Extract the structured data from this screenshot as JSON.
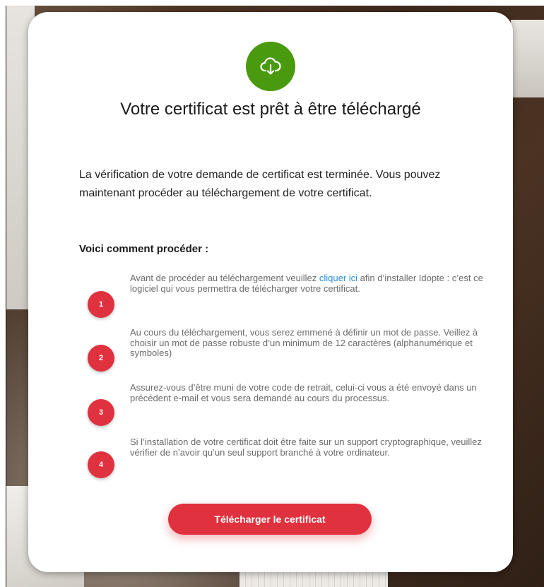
{
  "card": {
    "title": "Votre certificat est prêt à être téléchargé",
    "intro": "La vérification de votre demande de certificat est terminée. Vous pouvez maintenant procéder au téléchargement de votre certificat.",
    "how_title": "Voici comment procéder :",
    "icon": "cloud-download-icon",
    "icon_color": "#4a9a0f",
    "accent_color": "#e0313e",
    "link_color": "#2a8fd6"
  },
  "steps": [
    {
      "number": "1",
      "text_before": "Avant de procéder au téléchargement veuillez ",
      "link_text": "cliquer ici",
      "text_after": " afin d’installer Idopte : c’est ce logiciel qui vous permettra de télécharger votre certificat."
    },
    {
      "number": "2",
      "text": "Au cours du téléchargement, vous serez emmené à définir un mot de passe. Veillez à choisir un mot de passe robuste d’un minimum de 12 caractères (alphanumérique et symboles)"
    },
    {
      "number": "3",
      "text": "Assurez-vous d’être muni de votre code de retrait, celui-ci vous a été envoyé dans un précédent e-mail et vous sera demandé au cours du processus."
    },
    {
      "number": "4",
      "text": "Si l’installation de votre certificat doit être faite sur un support cryptographique, veuillez vérifier de n’avoir qu’un seul support branché à votre ordinateur."
    }
  ],
  "download_button": {
    "label": "Télécharger le certificat"
  }
}
